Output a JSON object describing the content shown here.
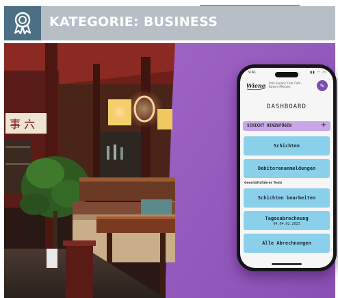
{
  "header": {
    "title": "KATEGORIE: BUSINESS",
    "badge_icon": "award-ribbon-icon",
    "band_color": "#b8bec6",
    "badge_color": "#4c6f86"
  },
  "photo": {
    "sign_text": "事 六"
  },
  "phone": {
    "status": {
      "time": "9:41",
      "icons": "▮▮ ◠ ▭"
    },
    "app": {
      "logo_text": "Wiener",
      "store_name": "Imbi Sarjan / Cafe Café · Bayern Meissen",
      "edit_icon": "pencil-icon",
      "dashboard_title": "DASHBOARD",
      "add_shift_label": "SCHICHT HINZUFÜGEN",
      "add_shift_icon": "+",
      "buttons_top": [
        {
          "label": "Schichten"
        },
        {
          "label": "Debitorenanmeldungen"
        }
      ],
      "section_label": "Geschäftsführer Tools",
      "buttons_bottom": [
        {
          "label": "Schichten bearbeiten"
        },
        {
          "label": "Tagesabrechnung",
          "sub": "04.04.02.2023"
        },
        {
          "label": "Alle Abrechnungen"
        }
      ],
      "accent_color": "#8ad0ea",
      "add_shift_color": "#c9a6e6"
    }
  }
}
